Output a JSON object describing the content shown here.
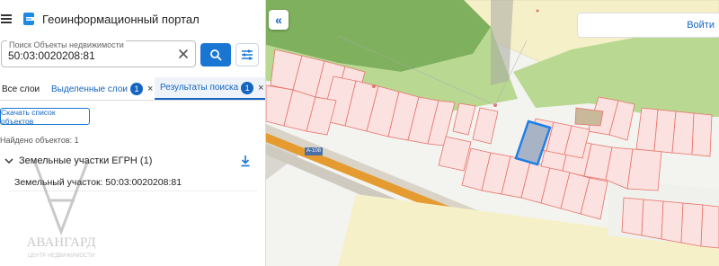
{
  "header": {
    "menu_icon": "hamburger-menu-icon",
    "logo_icon": "portal-logo-icon",
    "title": "Геоинформационный портал"
  },
  "search": {
    "label": "Поиск Объекты недвижимости",
    "value": "50:03:0020208:81",
    "clear_icon": "close-icon",
    "search_icon": "search-icon",
    "filter_icon": "filter-settings-icon",
    "accent_color": "#1976d2"
  },
  "tabs": [
    {
      "label": "Все слои"
    },
    {
      "label": "Выделенные слои",
      "badge": "1",
      "close": "×"
    },
    {
      "label": "Результаты поиска",
      "badge": "1",
      "close": "×"
    }
  ],
  "results": {
    "download_button": "Скачать список объектов",
    "found_text": "Найдено объектов: 1",
    "group_label": "Земельные участки ЕГРН (1)",
    "group_icon": "chevron-down-icon",
    "download_icon": "download-icon",
    "item_label": "Земельный участок: 50:03:0020208:81"
  },
  "watermark": {
    "text": "АВАНГАРД",
    "subtext": "ЦЕНТР НЕДВИЖИМОСТИ"
  },
  "map": {
    "collapse_label": "«",
    "login_label": "Войти",
    "road_label": "А-108",
    "colors": {
      "forest": "#7fb05e",
      "meadow": "#b9d992",
      "parcel_stroke": "#e8736b",
      "parcel_fill": "#fbe1df",
      "selected_stroke": "#1e7fe6",
      "road": "#e59b2f",
      "yellow_zone": "#f6f0c9"
    }
  }
}
